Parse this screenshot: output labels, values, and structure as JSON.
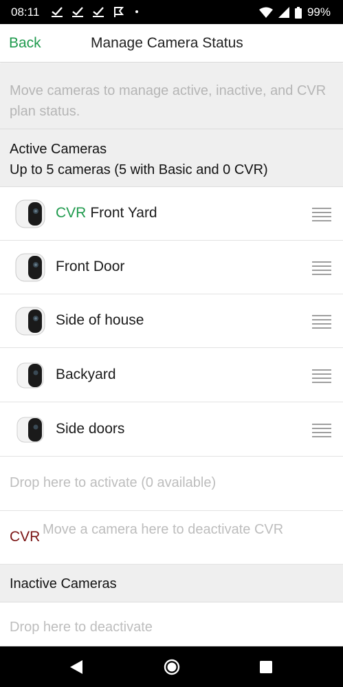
{
  "status_bar": {
    "time": "08:11",
    "battery": "99%"
  },
  "header": {
    "back_label": "Back",
    "title": "Manage Camera Status"
  },
  "hint": "Move cameras to manage active, inactive, and CVR plan status.",
  "active_section": {
    "title": "Active Cameras",
    "subtitle": "Up to 5 cameras (5 with Basic and 0 CVR)"
  },
  "cameras": [
    {
      "cvr": "CVR",
      "name": "Front Yard"
    },
    {
      "cvr": "",
      "name": "Front Door"
    },
    {
      "cvr": "",
      "name": "Side of house"
    },
    {
      "cvr": "",
      "name": "Backyard"
    },
    {
      "cvr": "",
      "name": "Side doors"
    }
  ],
  "drop_activate": "Drop here to activate (0 available)",
  "cvr_drop": {
    "label": "CVR",
    "text": "Move a camera here to deactivate CVR"
  },
  "inactive_section": {
    "title": "Inactive Cameras"
  },
  "drop_deactivate": "Drop here to deactivate",
  "colors": {
    "accent": "#1f9a4d",
    "cvr_red": "#7a1414",
    "muted_text": "#b5b5b5",
    "section_bg": "#efefef"
  },
  "icons": [
    "check-icon",
    "flag-icon",
    "wifi-icon",
    "signal-icon",
    "battery-icon",
    "camera-icon",
    "drag-handle-icon",
    "nav-back-icon",
    "nav-home-icon",
    "nav-recent-icon"
  ]
}
